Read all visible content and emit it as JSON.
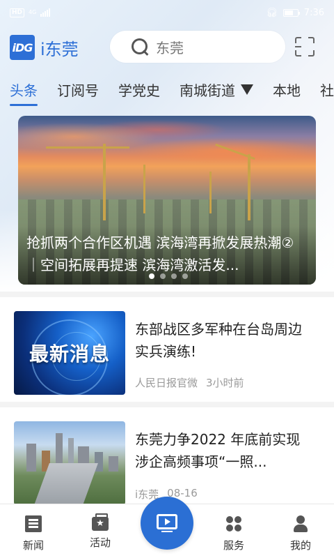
{
  "status_bar": {
    "hd_badge": "HD",
    "network": "4G",
    "time": "7:36"
  },
  "header": {
    "logo_mark": "iDG",
    "app_name": "i东莞",
    "search_placeholder": "东莞"
  },
  "tabs": [
    {
      "label": "头条",
      "active": true
    },
    {
      "label": "订阅号",
      "active": false
    },
    {
      "label": "学党史",
      "active": false
    },
    {
      "label": "南城街道",
      "active": false,
      "dropdown": true
    },
    {
      "label": "本地",
      "active": false
    },
    {
      "label": "社",
      "active": false
    }
  ],
  "banner": {
    "title": "抢抓两个合作区机遇 滨海湾再掀发展热潮②｜空间拓展再提速 滨海湾激活发...",
    "slide_count": 4,
    "active_slide": 1
  },
  "news": [
    {
      "title": "东部战区多军种在台岛周边实兵演练!",
      "thumb_text": "最新消息",
      "source": "人民日报官微",
      "time": "3小时前"
    },
    {
      "title": "东莞力争2022 年底前实现涉企高频事项“一照...",
      "thumb_text": "",
      "source": "i东莞",
      "time": "08-16"
    }
  ],
  "bottom_nav": [
    {
      "label": "新闻",
      "icon": "news-icon"
    },
    {
      "label": "活动",
      "icon": "activity-icon"
    },
    {
      "label": "",
      "icon": "video-icon"
    },
    {
      "label": "服务",
      "icon": "service-icon"
    },
    {
      "label": "我的",
      "icon": "profile-icon"
    }
  ],
  "colors": {
    "brand": "#2d6fd6",
    "tab_active": "#2d6fd6",
    "meta_text": "#9a9a9a"
  }
}
